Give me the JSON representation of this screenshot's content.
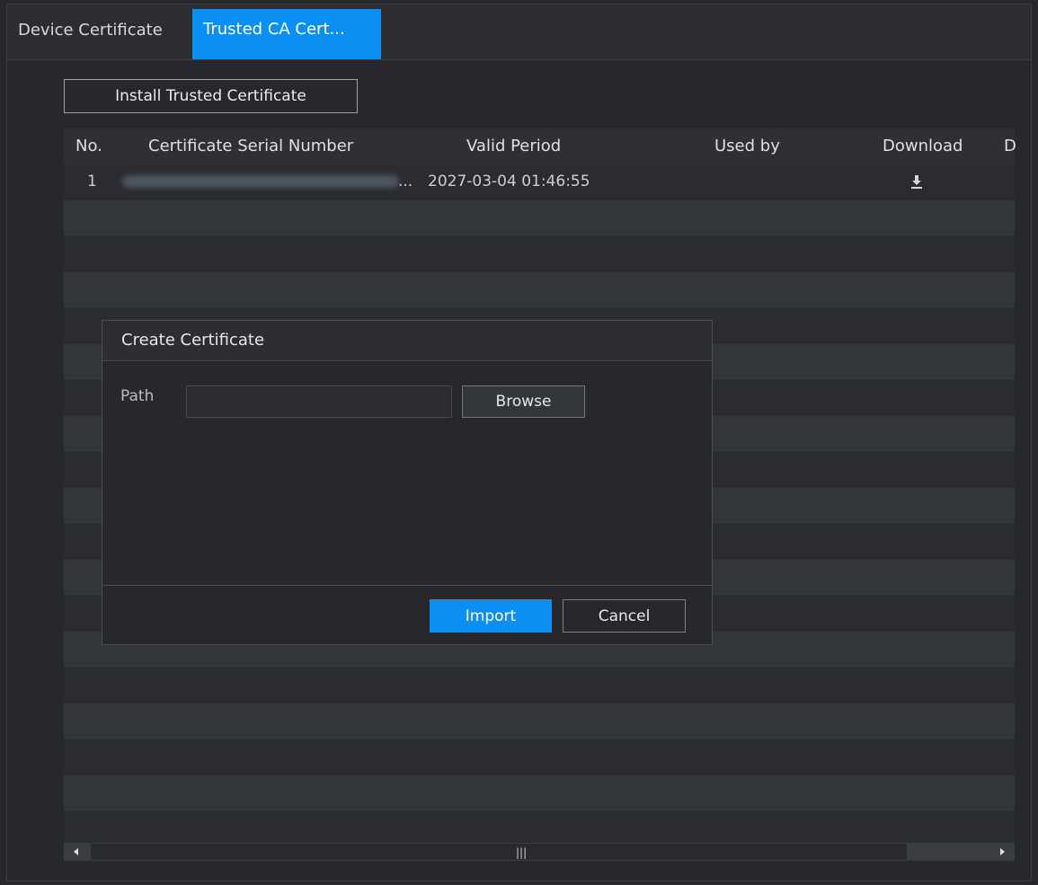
{
  "tabs": [
    {
      "label": "Device Certificate",
      "active": false
    },
    {
      "label": "Trusted CA Cert...",
      "active": true
    }
  ],
  "toolbar": {
    "install_label": "Install Trusted Certificate"
  },
  "table": {
    "headers": {
      "no": "No.",
      "serial": "Certificate Serial Number",
      "valid": "Valid Period",
      "used_by": "Used by",
      "download": "Download",
      "delete_partial": "D"
    },
    "rows": [
      {
        "no": "1",
        "serial_ellipsis": "...",
        "valid": "2027-03-04 01:46:55",
        "used_by": "",
        "download_icon": "download-icon"
      }
    ]
  },
  "scrollbar": {
    "grip": "|||"
  },
  "dialog": {
    "title": "Create Certificate",
    "path_label": "Path",
    "path_value": "",
    "browse_label": "Browse",
    "import_label": "Import",
    "cancel_label": "Cancel"
  },
  "colors": {
    "accent": "#0c8ff2",
    "background": "#26282d"
  }
}
